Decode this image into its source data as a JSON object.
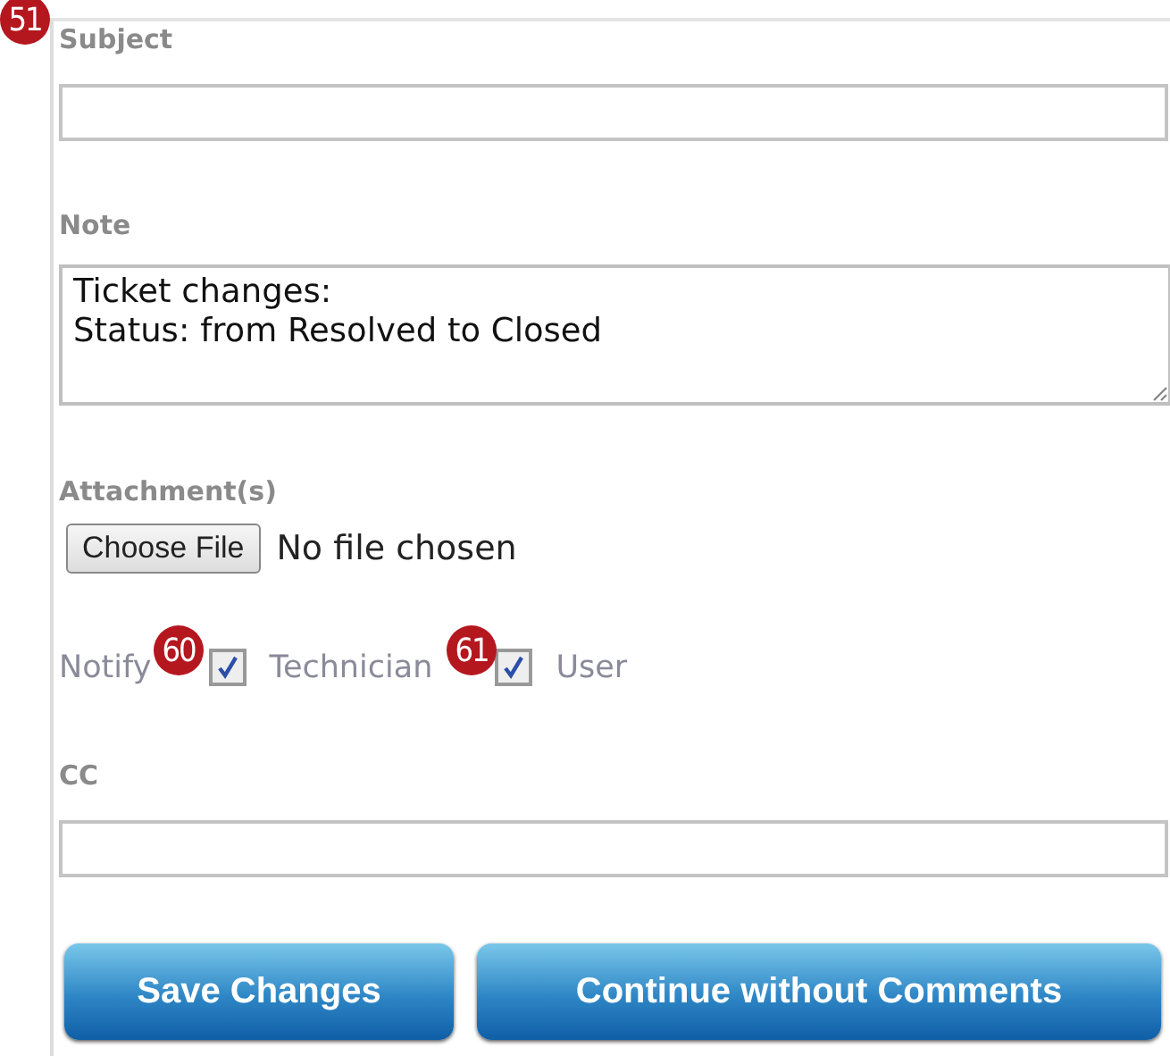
{
  "badges": [
    {
      "text": "51"
    },
    {
      "text": "60"
    },
    {
      "text": "61"
    }
  ],
  "subject": {
    "label": "Subject"
  },
  "note": {
    "label": "Note",
    "lines": [
      "Ticket changes:",
      "Status: from Resolved to Closed"
    ]
  },
  "attachments": {
    "label": "Attachment(s)",
    "button": "Choose File",
    "status": "No file chosen"
  },
  "notify": {
    "label": "Notify",
    "options": [
      {
        "label": "Technician",
        "checked": true
      },
      {
        "label": "User",
        "checked": true
      }
    ]
  },
  "cc": {
    "label": "CC"
  },
  "buttons": [
    "Save Changes",
    "Continue without Comments"
  ]
}
